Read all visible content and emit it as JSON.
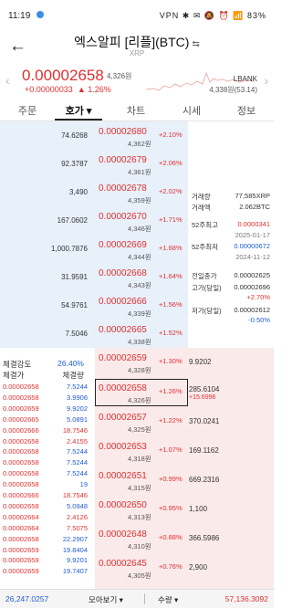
{
  "status_bar": {
    "time": "11:19",
    "right": "VPN ✱ ✉ 🔕 ⏰ 📶 83%"
  },
  "header": {
    "title": "엑스알피 [리플](BTC)",
    "swap": "⇆",
    "subtitle": "XRP",
    "back": "←"
  },
  "price": {
    "value": "0.00002658",
    "krw": "4,326원",
    "change": "+0.00000033",
    "change_pct": "▲ 1.26%",
    "exchange": "LBANK",
    "exchange_sub": "4,338원(53.14)",
    "left_chev": "‹",
    "right_chev": "›"
  },
  "tabs": [
    "주문",
    "호가 ▾",
    "차트",
    "시세",
    "정보"
  ],
  "sell_orders": [
    {
      "qty": "74.6268",
      "price": "0.00002680",
      "krw": "4,362원",
      "pct": "+2.10%"
    },
    {
      "qty": "92.3787",
      "price": "0.00002679",
      "krw": "4,361원",
      "pct": "+2.06%"
    },
    {
      "qty": "3,490",
      "price": "0.00002678",
      "krw": "4,359원",
      "pct": "+2.02%"
    },
    {
      "qty": "167.0602",
      "price": "0.00002670",
      "krw": "4,346원",
      "pct": "+1.71%"
    },
    {
      "qty": "1,000.7876",
      "price": "0.00002669",
      "krw": "4,344원",
      "pct": "+1.68%"
    },
    {
      "qty": "31.9591",
      "price": "0.00002668",
      "krw": "4,343원",
      "pct": "+1.64%"
    },
    {
      "qty": "54.9761",
      "price": "0.00002666",
      "krw": "4,339원",
      "pct": "+1.56%"
    },
    {
      "qty": "7.5046",
      "price": "0.00002665",
      "krw": "4,338원",
      "pct": "+1.52%"
    }
  ],
  "buy_orders": [
    {
      "qty": "9.9202",
      "price": "0.00002659",
      "krw": "4,328원",
      "pct": "+1.30%"
    },
    {
      "qty": "285.6104",
      "price": "0.00002658",
      "krw": "4,326원",
      "pct": "+1.26%"
    },
    {
      "qty": "370.0241",
      "price": "0.00002657",
      "krw": "4,325원",
      "pct": "+1.22%"
    },
    {
      "qty": "169.1162",
      "price": "0.00002653",
      "krw": "4,318원",
      "pct": "+1.07%"
    },
    {
      "qty": "669.2316",
      "price": "0.00002651",
      "krw": "4,315원",
      "pct": "+0.99%"
    },
    {
      "qty": "1,100",
      "price": "0.00002650",
      "krw": "4,313원",
      "pct": "+0.95%"
    },
    {
      "qty": "366.5986",
      "price": "0.00002648",
      "krw": "4,310원",
      "pct": "+0.88%"
    },
    {
      "qty": "2,900",
      "price": "0.00002645",
      "krw": "4,305원",
      "pct": "+0.76%"
    }
  ],
  "current_order_extra": "+15.6996",
  "market_info": {
    "volume_label": "거래량",
    "volume": "77,585XRP",
    "value_label": "거래액",
    "value": "2.062BTC",
    "high52_label": "52주최고",
    "high52": "0.0000341",
    "high52_date": "2025-01-17",
    "low52_label": "52주최저",
    "low52": "0.00000672",
    "low52_date": "2024-11-12",
    "prev_label": "전일종가",
    "prev": "0.00002625",
    "dayhigh_label": "고가(당일)",
    "dayhigh": "0.00002696",
    "dayhigh_pct": "+2.70%",
    "daylow_label": "저가(당일)",
    "daylow": "0.00002612",
    "daylow_pct": "-0.50%"
  },
  "trades": {
    "strength_label": "체결강도",
    "strength": "26.40%",
    "price_label": "체결가",
    "qty_label": "체결량",
    "rows": [
      {
        "p": "0.00002658",
        "v": "7.5244",
        "c": "blue"
      },
      {
        "p": "0.00002658",
        "v": "3.9906",
        "c": "blue"
      },
      {
        "p": "0.00002659",
        "v": "9.9202",
        "c": "blue"
      },
      {
        "p": "0.00002665",
        "v": "5.0891",
        "c": "blue"
      },
      {
        "p": "0.00002666",
        "v": "18.7546",
        "c": "red"
      },
      {
        "p": "0.00002658",
        "v": "2.4155",
        "c": "red"
      },
      {
        "p": "0.00002658",
        "v": "7.5244",
        "c": "blue"
      },
      {
        "p": "0.00002658",
        "v": "7.5244",
        "c": "blue"
      },
      {
        "p": "0.00002658",
        "v": "7.5244",
        "c": "blue"
      },
      {
        "p": "0.00002658",
        "v": "19",
        "c": "blue"
      },
      {
        "p": "0.00002666",
        "v": "18.7546",
        "c": "red"
      },
      {
        "p": "0.00002658",
        "v": "5.0948",
        "c": "blue"
      },
      {
        "p": "0.00002664",
        "v": "2.4126",
        "c": "red"
      },
      {
        "p": "0.00002664",
        "v": "7.5075",
        "c": "red"
      },
      {
        "p": "0.00002658",
        "v": "22.2907",
        "c": "blue"
      },
      {
        "p": "0.00002659",
        "v": "19.8404",
        "c": "blue"
      },
      {
        "p": "0.00002659",
        "v": "9.9201",
        "c": "blue"
      },
      {
        "p": "0.00002659",
        "v": "19.7407",
        "c": "blue"
      }
    ]
  },
  "bottom": {
    "left_total": "26,247.0257",
    "left_btn": "모아보기",
    "right_btn": "수량",
    "right_total": "57,136.3092",
    "caret": "▾"
  },
  "colors": {
    "up": "#e03030",
    "down": "#1f5bd6",
    "sell_bg": "#e8f0fa",
    "buy_bg": "#fbeaea"
  }
}
